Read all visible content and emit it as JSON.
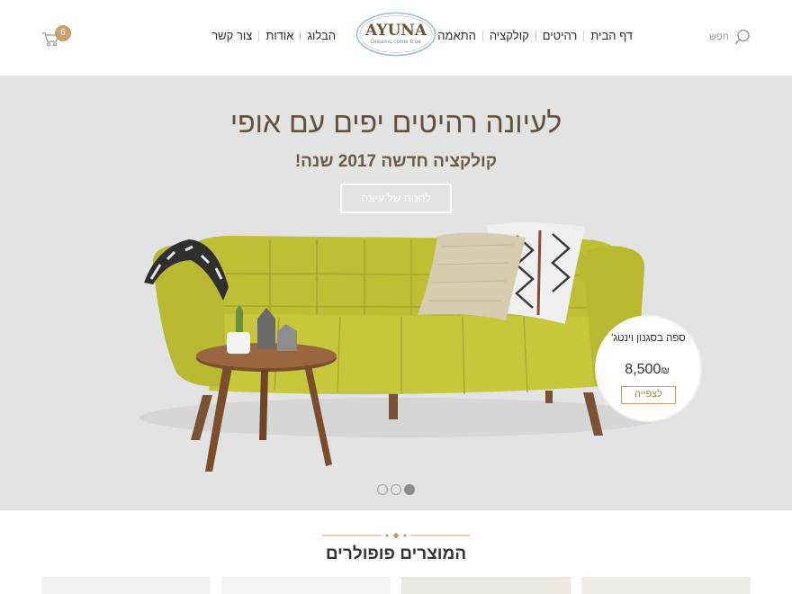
{
  "header": {
    "search_label": "חפש",
    "nav_right": [
      "דף הבית",
      "רהיטים",
      "קולקציה",
      "התאמה אישי"
    ],
    "nav_left": [
      "הבלוג",
      "אודות",
      "צור קשר"
    ],
    "logo": {
      "brand": "AYUNA",
      "tagline": "Dreams come true"
    },
    "cart_count": "6"
  },
  "hero": {
    "title": "לעיונה רהיטים יפים עם אופי",
    "subtitle": "קולקציה חדשה 2017 שנה!",
    "cta_label": "לחנות של עיונה",
    "price_card": {
      "name": "ספה בסגנון וינטג'",
      "price": "8,500",
      "currency": "₪",
      "button_label": "לצפייה"
    },
    "slides_total": 3,
    "active_slide": 3
  },
  "popular": {
    "title": "המוצרים פופולרים"
  },
  "colors": {
    "accent_gold": "#c6a16a",
    "sofa_green": "#c4c43a",
    "hero_bg": "#e3e3e3",
    "title_brown": "#5f5040"
  }
}
